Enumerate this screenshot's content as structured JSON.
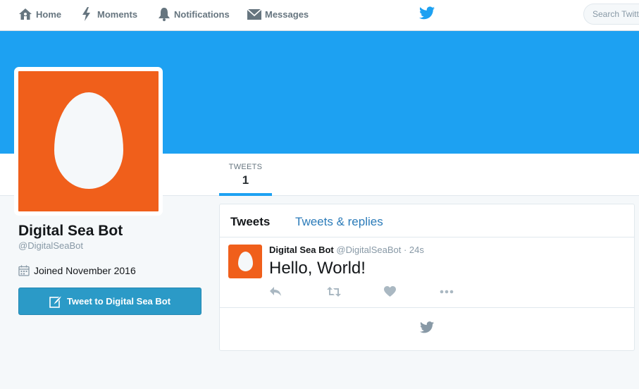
{
  "nav": {
    "items": [
      {
        "label": "Home",
        "icon": "home-icon"
      },
      {
        "label": "Moments",
        "icon": "lightning-icon"
      },
      {
        "label": "Notifications",
        "icon": "bell-icon"
      },
      {
        "label": "Messages",
        "icon": "envelope-icon"
      }
    ],
    "logo_icon": "twitter-bird-icon",
    "search_placeholder": "Search Twitt"
  },
  "profile": {
    "name": "Digital Sea Bot",
    "handle": "@DigitalSeaBot",
    "joined": "Joined November 2016",
    "tweet_to_label": "Tweet to Digital Sea Bot"
  },
  "stats": {
    "tweets_label": "TWEETS",
    "tweets_value": "1"
  },
  "timeline": {
    "tabs": [
      "Tweets",
      "Tweets & replies"
    ],
    "tweets": [
      {
        "name": "Digital Sea Bot",
        "handle": "@DigitalSeaBot",
        "time": "· 24s",
        "text": "Hello, World!"
      }
    ]
  },
  "colors": {
    "brand_blue": "#1da1f2",
    "avatar_orange": "#f05f1b",
    "button_blue": "#2b9ac7",
    "link_blue": "#2b7bb9"
  }
}
